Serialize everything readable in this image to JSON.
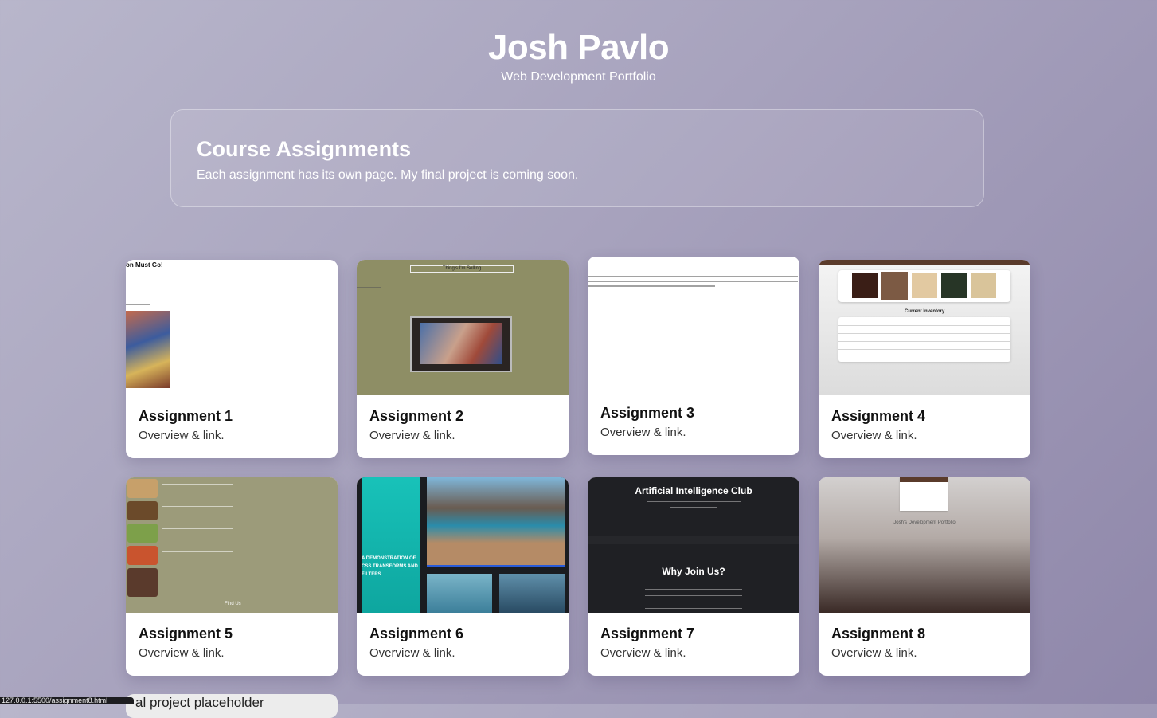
{
  "header": {
    "title": "Josh Pavlo",
    "subtitle": "Web Development Portfolio"
  },
  "intro": {
    "title": "Course Assignments",
    "text": "Each assignment has its own page. My final project is coming soon."
  },
  "cards": [
    {
      "title": "Assignment 1",
      "desc": "Overview & link.",
      "thumb_caption": "on Must Go!"
    },
    {
      "title": "Assignment 2",
      "desc": "Overview & link.",
      "thumb_caption": "Thing's I'm Selling"
    },
    {
      "title": "Assignment 3",
      "desc": "Overview & link."
    },
    {
      "title": "Assignment 4",
      "desc": "Overview & link.",
      "thumb_caption": "Current Inventory"
    },
    {
      "title": "Assignment 5",
      "desc": "Overview & link.",
      "thumb_caption": "Find Us"
    },
    {
      "title": "Assignment 6",
      "desc": "Overview & link.",
      "thumb_caption": "A DEMONSTRATION OF CSS TRANSFORMS AND FILTERS"
    },
    {
      "title": "Assignment 7",
      "desc": "Overview & link.",
      "thumb_caption": "Artificial Intelligence Club",
      "thumb_caption2": "Why Join Us?"
    },
    {
      "title": "Assignment 8",
      "desc": "Overview & link.",
      "thumb_caption": "Josh's Development Portfolio"
    }
  ],
  "placeholder": {
    "text": "al project placeholder"
  },
  "status": {
    "url": "127.0.0.1:5500/assignment8.html"
  },
  "colors": {
    "card_bg": "#ffffff",
    "olive_thumb": "#8e8e65",
    "teal_accent": "#14b8b0",
    "dark_thumb": "#1f2024",
    "brown_header": "#5a3b2b"
  }
}
